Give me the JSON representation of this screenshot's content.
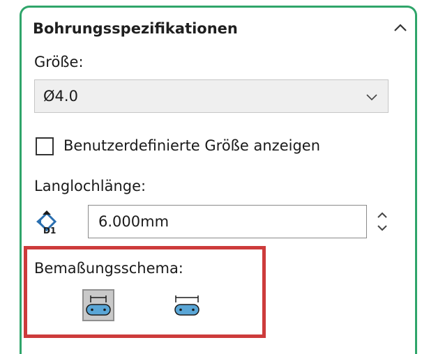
{
  "panel": {
    "title": "Bohrungsspezifikationen",
    "collapse_icon": "chevron-up-icon"
  },
  "size": {
    "label": "Größe:",
    "selected": "Ø4.0",
    "dropdown_icon": "chevron-down-icon"
  },
  "custom_size": {
    "label": "Benutzerdefinierte Größe anzeigen",
    "checked": false
  },
  "slot_length": {
    "label": "Langlochlänge:",
    "value": "6.000mm",
    "dimension_icon_text": "D1"
  },
  "dimension_scheme": {
    "label": "Bemaßungsschema:",
    "options": [
      {
        "name": "center-to-center",
        "icon": "slot-center-dimension-icon",
        "selected": true
      },
      {
        "name": "overall-length",
        "icon": "slot-overall-dimension-icon",
        "selected": false
      }
    ]
  },
  "colors": {
    "panel_border": "#2fa56a",
    "highlight": "#cd3b3b",
    "slot_fill": "#5aa6d6"
  }
}
